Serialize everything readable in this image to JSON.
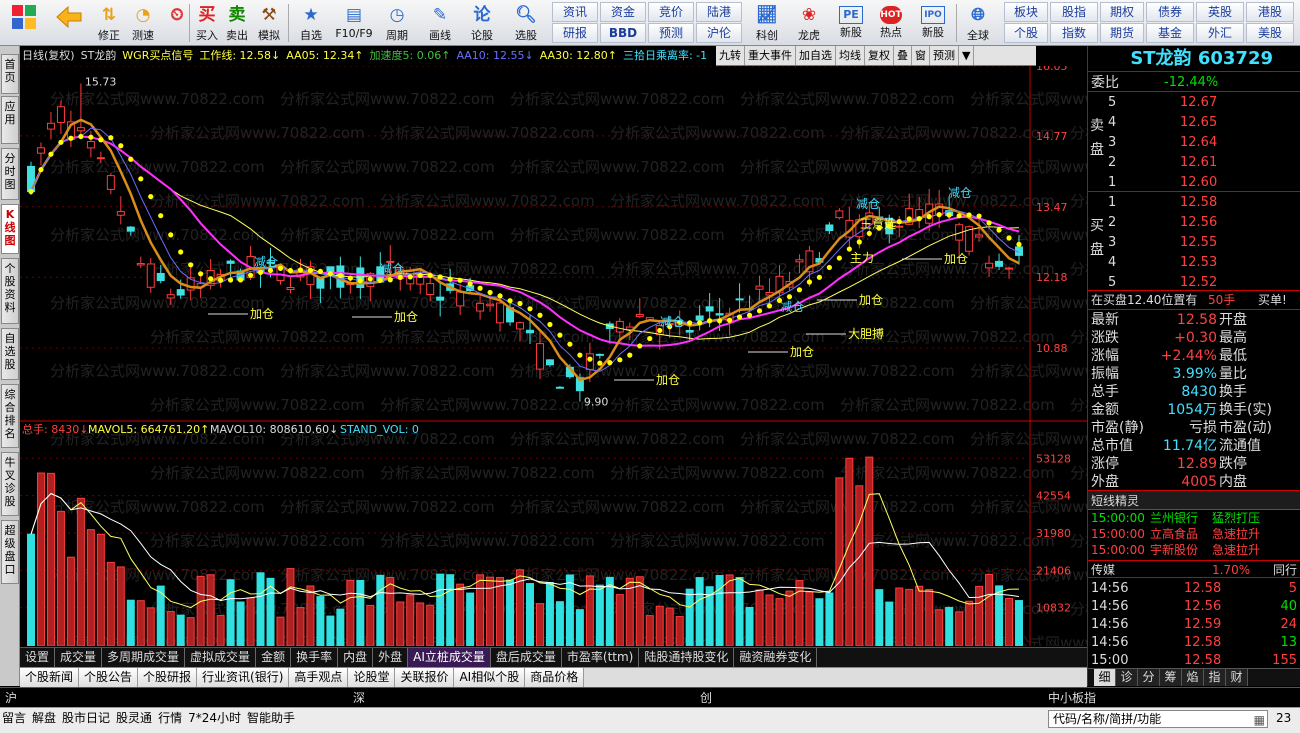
{
  "toolbar": {
    "left": [
      {
        "label": "",
        "icon": "grid"
      },
      {
        "label": "",
        "icon": "back"
      },
      {
        "label": "修正",
        "icon": "up-down"
      },
      {
        "label": "测速",
        "icon": "speed"
      },
      {
        "label": "买入",
        "icon": "buy"
      },
      {
        "label": "卖出",
        "icon": "sell"
      },
      {
        "label": "模拟",
        "icon": "hammer"
      },
      {
        "label": "自选",
        "icon": "star"
      },
      {
        "label": "F10/F9",
        "icon": "f10"
      },
      {
        "label": "周期",
        "icon": "clock"
      },
      {
        "label": "画线",
        "icon": "pen"
      },
      {
        "label": "论股",
        "icon": "talk"
      },
      {
        "label": "选股",
        "icon": "magnifier"
      }
    ],
    "buy_glyph": "买",
    "sell_glyph": "卖",
    "talk_glyph": "论",
    "links_row1": [
      "资讯",
      "资金",
      "竞价",
      "陆港"
    ],
    "links_row2": [
      "研报",
      "BBD",
      "预测",
      "沪伦"
    ],
    "mid": [
      {
        "label": "科创"
      },
      {
        "label": "龙虎"
      },
      {
        "label": "新股"
      },
      {
        "label": "热点"
      },
      {
        "label": "新股"
      }
    ],
    "pe_glyph": "PE",
    "hot_glyph": "HOT",
    "ipo_glyph": "IPO",
    "globe_label": "全球",
    "right_row1": [
      "板块",
      "股指",
      "期权",
      "债券",
      "英股",
      "港股"
    ],
    "right_row2": [
      "个股",
      "指数",
      "期货",
      "基金",
      "外汇",
      "美股"
    ]
  },
  "left_tabs": [
    "首页",
    "应用",
    "分时图",
    "K线图",
    "个股资料",
    "自选股",
    "综合排名",
    "牛叉诊股",
    "超级盘口"
  ],
  "indicator_bar": {
    "period": "日线(复权)",
    "name": "ST龙韵",
    "wgr": "WGR买点信号",
    "work": "工作线: 12.58↓",
    "aa05": "AA05: 12.34↑",
    "jsd": "加速度5: 0.06↑",
    "aa10": "AA10: 12.55↓",
    "aa30": "AA30: 12.80↑",
    "ratio": "三拾日乘离率: -1"
  },
  "chart_buttons": [
    "九转",
    "重大事件",
    "加自选",
    "均线",
    "复权",
    "叠",
    "窗",
    "预测",
    "▼"
  ],
  "stock": {
    "title": "ST龙韵",
    "code": "603729"
  },
  "order_book": {
    "weibi_label": "委比",
    "weibi": "-12.44%",
    "sell_label": "卖盘",
    "buy_label": "买盘",
    "sells": [
      {
        "lvl": "5",
        "price": "12.67"
      },
      {
        "lvl": "4",
        "price": "12.65"
      },
      {
        "lvl": "3",
        "price": "12.64"
      },
      {
        "lvl": "2",
        "price": "12.61"
      },
      {
        "lvl": "1",
        "price": "12.60"
      }
    ],
    "buys": [
      {
        "lvl": "1",
        "price": "12.58"
      },
      {
        "lvl": "2",
        "price": "12.56"
      },
      {
        "lvl": "3",
        "price": "12.55"
      },
      {
        "lvl": "4",
        "price": "12.53"
      },
      {
        "lvl": "5",
        "price": "12.52"
      }
    ],
    "notice": "在买盘12.40位置有",
    "notice_qty": "50手",
    "notice_act": "买单!"
  },
  "quote": [
    {
      "l": "最新",
      "v": "12.58",
      "c": "red",
      "l2": "开盘",
      "v2": ""
    },
    {
      "l": "涨跌",
      "v": "+0.30",
      "c": "red",
      "l2": "最高",
      "v2": ""
    },
    {
      "l": "涨幅",
      "v": "+2.44%",
      "c": "red",
      "l2": "最低",
      "v2": ""
    },
    {
      "l": "振幅",
      "v": "3.99%",
      "c": "cyan",
      "l2": "量比",
      "v2": ""
    },
    {
      "l": "总手",
      "v": "8430",
      "c": "cyan",
      "l2": "换手",
      "v2": ""
    },
    {
      "l": "金额",
      "v": "1054万",
      "c": "cyan",
      "l2": "换手(实)",
      "v2": ""
    },
    {
      "l": "市盈(静)",
      "v": "亏损",
      "c": "wht",
      "l2": "市盈(动)",
      "v2": ""
    },
    {
      "l": "总市值",
      "v": "11.74亿",
      "c": "cyan",
      "l2": "流通值",
      "v2": ""
    },
    {
      "l": "涨停",
      "v": "12.89",
      "c": "red",
      "l2": "跌停",
      "v2": ""
    },
    {
      "l": "外盘",
      "v": "4005",
      "c": "red",
      "l2": "内盘",
      "v2": ""
    }
  ],
  "elite": {
    "title": "短线精灵",
    "rows": [
      {
        "t": "15:00:00",
        "name": "兰州银行",
        "ev": "猛烈打压",
        "c": "grn"
      },
      {
        "t": "15:00:00",
        "name": "立高食品",
        "ev": "急速拉升",
        "c": "red"
      },
      {
        "t": "15:00:00",
        "name": "宇新股份",
        "ev": "急速拉升",
        "c": "red"
      }
    ]
  },
  "sector": {
    "name": "传媒",
    "pct": "1.70%",
    "extra": "同行"
  },
  "ticks": [
    {
      "t": "14:56",
      "p": "12.58",
      "v": "5",
      "c": "red"
    },
    {
      "t": "14:56",
      "p": "12.56",
      "v": "40",
      "c": "grn"
    },
    {
      "t": "14:56",
      "p": "12.59",
      "v": "24",
      "c": "red"
    },
    {
      "t": "14:56",
      "p": "12.58",
      "v": "13",
      "c": "grn"
    },
    {
      "t": "15:00",
      "p": "12.58",
      "v": "155",
      "c": "red"
    }
  ],
  "tick_tabs": [
    "细",
    "诊",
    "分",
    "筹",
    "焰",
    "指",
    "财"
  ],
  "price_axis": [
    "16.05",
    "14.77",
    "13.47",
    "12.18",
    "10.88"
  ],
  "vol_axis": [
    "53128",
    "42554",
    "31980",
    "21406",
    "10832"
  ],
  "annotations": {
    "high": "15.73",
    "low": "9.90",
    "jiacang": "加仓",
    "jiancang": "减仓",
    "zhuli": "主力",
    "daliangbo": "大胆搏",
    "wangyi": "王意选"
  },
  "vol_header": {
    "zs": "总手: 8430↓",
    "mavol5": "MAVOL5: 664761.20↑",
    "mavol10": "MAVOL10: 808610.60↓",
    "stand": "STAND_VOL: 0"
  },
  "watermark": "分析家公式网www.70822.com",
  "chart_data": [
    {
      "type": "candlestick",
      "title": "ST龙韵",
      "y_axis": [
        10.88,
        12.18,
        13.47,
        14.77,
        16.05
      ],
      "high": 15.73,
      "low": 9.9,
      "last": 12.58,
      "candles_count": 100
    },
    {
      "type": "bar",
      "title": "总手",
      "y_axis": [
        10832,
        21406,
        31980,
        42554,
        53128
      ]
    }
  ],
  "bottom_tabs": [
    "设置",
    "成交量",
    "多周期成交量",
    "虚拟成交量",
    "金额",
    "换手率",
    "内盘",
    "外盘",
    "AI立桩成交量",
    "盘后成交量",
    "市盈率(ttm)",
    "陆股通持股变化",
    "融资融券变化"
  ],
  "bottom_tabs2": [
    "个股新闻",
    "个股公告",
    "个股研报",
    "行业资讯(银行)",
    "高手观点",
    "论股堂",
    "关联报价",
    "AI相似个股",
    "商品价格"
  ],
  "status": {
    "sh": "沪",
    "sz": "深",
    "cy": "创",
    "zxb": "中小板指"
  },
  "status2": [
    "留言",
    "解盘",
    "股市日记",
    "股灵通",
    "行情",
    "7*24小时",
    "智能助手"
  ],
  "search_placeholder": "代码/名称/简拼/功能",
  "clock": "23"
}
